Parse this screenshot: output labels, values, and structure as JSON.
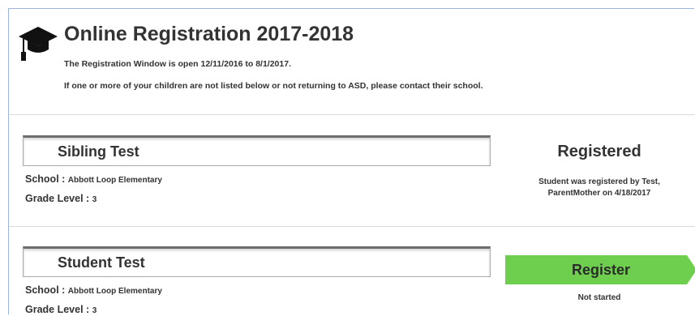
{
  "header": {
    "icon": "graduation-cap-icon",
    "title": "Online Registration 2017-2018",
    "window_notice": "The Registration Window is open 12/11/2016 to 8/1/2017.",
    "contact_notice": "If one or more of your children are not listed below or not returning to ASD, please contact their school."
  },
  "students": [
    {
      "name": "Sibling Test",
      "school_label": "School :",
      "school": "Abbott Loop Elementary",
      "grade_label": "Grade Level :",
      "grade": "3",
      "status": "Registered",
      "status_note_line1": "Student was registered by Test,",
      "status_note_line2": "ParentMother on 4/18/2017"
    },
    {
      "name": "Student Test",
      "school_label": "School :",
      "school": "Abbott Loop Elementary",
      "grade_label": "Grade Level :",
      "grade": "3",
      "action_label": "Register",
      "action_color": "#6ecf4f",
      "status_note": "Not started"
    }
  ]
}
